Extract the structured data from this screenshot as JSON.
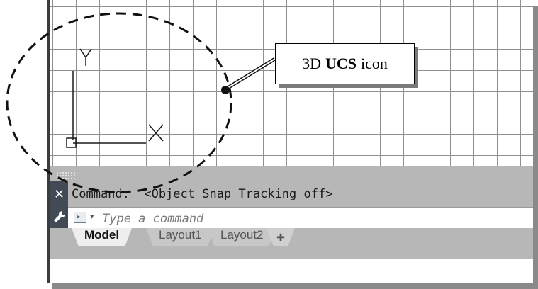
{
  "viewport": {
    "ucs_axis_y": "Y",
    "ucs_axis_x": "X"
  },
  "callout": {
    "prefix": "3D",
    "bold": "UCS",
    "suffix": "icon"
  },
  "command_line": {
    "history": "Command:  <Object Snap Tracking off>",
    "input_placeholder": "Type a command",
    "close_glyph": "✕",
    "prompt_glyph": ">_",
    "dropdown_glyph": "▾"
  },
  "tabs": [
    {
      "label": "Model",
      "active": true
    },
    {
      "label": "Layout1",
      "active": false
    },
    {
      "label": "Layout2",
      "active": false
    }
  ],
  "add_tab_glyph": "✚",
  "icons": {
    "close": "close-icon",
    "wrench": "wrench-icon",
    "prompt": "command-prompt-icon",
    "add": "add-layout-icon",
    "grip": "grip-handle-icon"
  },
  "colors": {
    "grid_line": "#8f8f8f",
    "cmd_background": "#b7b7b7",
    "side_strip": "#424a55"
  }
}
